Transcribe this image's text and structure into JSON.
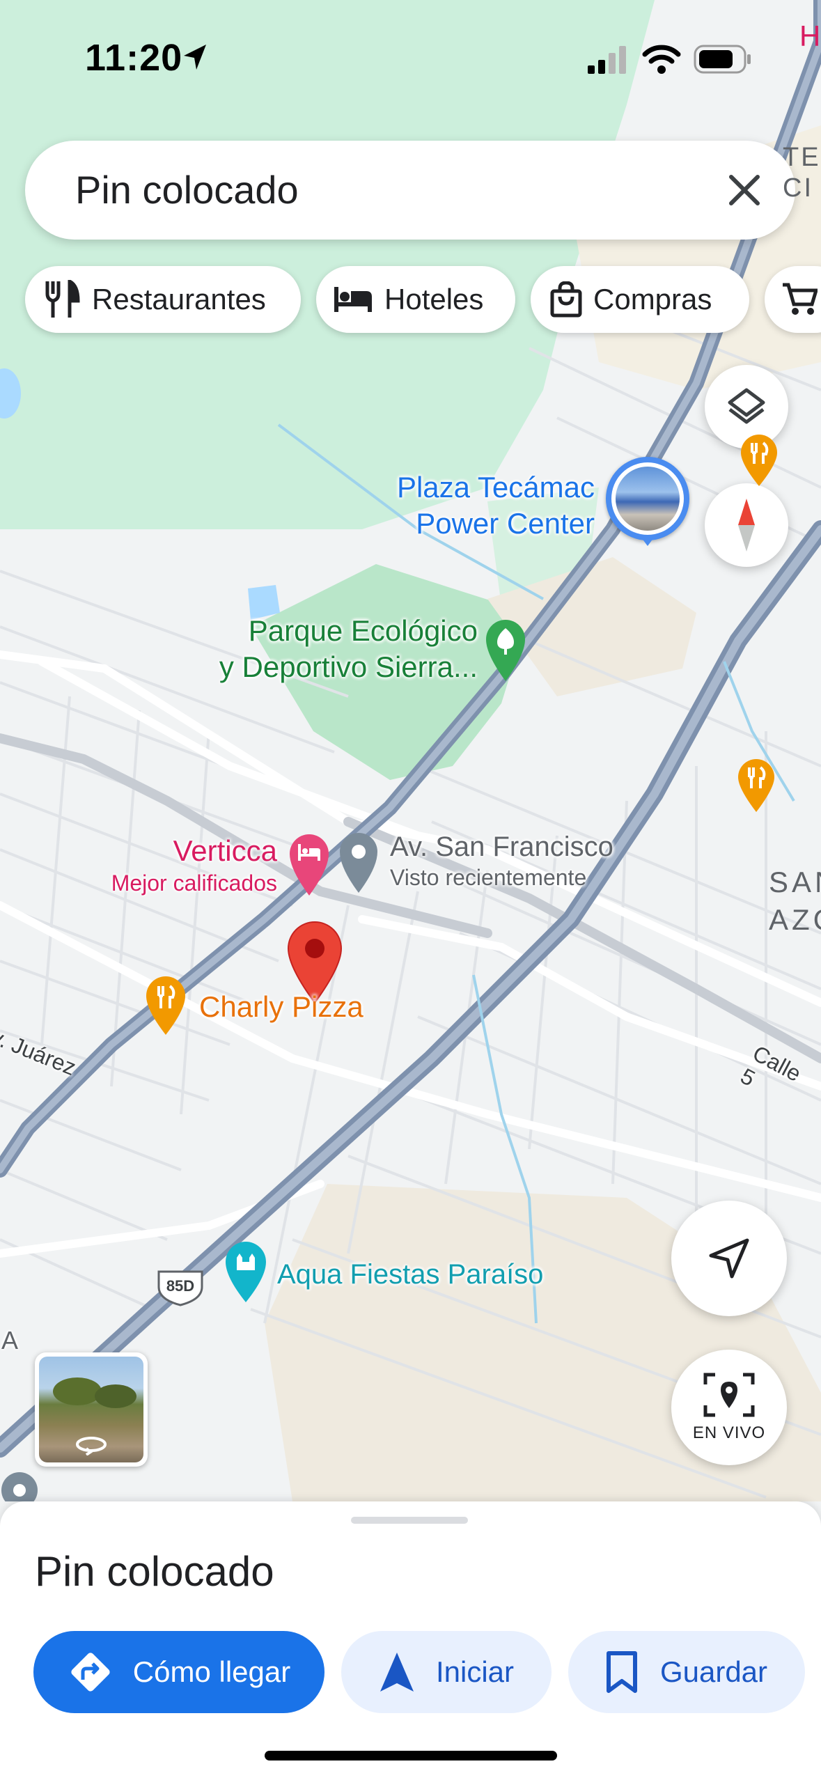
{
  "status": {
    "time": "11:20"
  },
  "search": {
    "text": "Pin colocado"
  },
  "chips": [
    {
      "label": "Restaurantes",
      "icon": "restaurant-icon"
    },
    {
      "label": "Hoteles",
      "icon": "bed-icon"
    },
    {
      "label": "Compras",
      "icon": "shopping-bag-icon"
    }
  ],
  "map": {
    "poi_plaza": [
      "Plaza Tecámac",
      "Power Center"
    ],
    "poi_parque": [
      "Parque Ecológico",
      "y Deportivo Sierra..."
    ],
    "poi_verticca": {
      "name": "Verticca",
      "sub": "Mejor calificados"
    },
    "poi_sanfrancisco": {
      "name": "Av. San Francisco",
      "sub": "Visto recientemente"
    },
    "poi_charly": "Charly Pizza",
    "poi_aqua": "Aqua Fiestas Paraíso",
    "road_juarez": "v. Juárez",
    "road_calle": "Calle 5",
    "area_san": [
      "SAN",
      "AZC"
    ],
    "area_tec": [
      "TEC",
      "CI"
    ],
    "edge_h": "H",
    "edge_a": "A",
    "highway_shield": "85D"
  },
  "controls": {
    "live_label": "EN VIVO"
  },
  "sheet": {
    "title": "Pin colocado",
    "buttons": {
      "directions": "Cómo llegar",
      "start": "Iniciar",
      "save": "Guardar"
    }
  },
  "colors": {
    "accent": "#1a73e8",
    "pin": "#ea4335",
    "park": "#cdeedd",
    "hotel": "#e8467a",
    "restaurant": "#f29900"
  }
}
